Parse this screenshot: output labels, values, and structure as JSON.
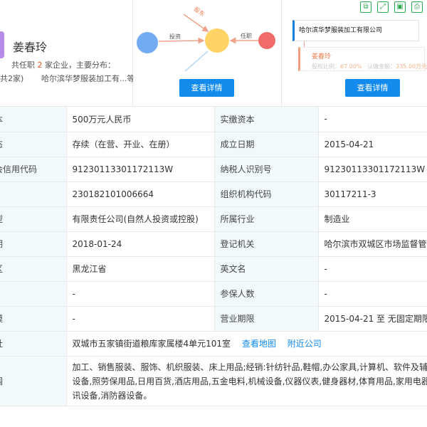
{
  "person": {
    "name": "姜春玲",
    "line1_prefix": "共任职",
    "line1_count": "2",
    "line1_suffix": "家企业，主要分布：",
    "line2_prefix": "共2家)",
    "line2_company": "哈尔滨华梦服装加工有...等"
  },
  "graph": {
    "label_invest": "投资",
    "label_share": "股东",
    "label_role": "任职",
    "colors": {
      "blue": "#5b9cf0",
      "orange": "#ffd366",
      "red": "#f05b5b",
      "arrow": "#f0a38a"
    }
  },
  "structure": {
    "company": "哈尔滨华梦服装加工有限公司",
    "holder_name": "姜春玲",
    "holder_ratio_label": "股权比例：",
    "holder_ratio_value": "67.00%",
    "holder_amount_label": "认缴金额：",
    "holder_amount_value": "335.00万元"
  },
  "toolbar": {
    "icons": [
      "copy-icon",
      "expand-icon",
      "save-icon",
      "print-icon"
    ]
  },
  "buttons": {
    "detail_left": "查看详情",
    "detail_right": "查看详情"
  },
  "table": {
    "rows": [
      {
        "l1": "本",
        "v1": "500万元人民币",
        "l2": "实缴资本",
        "v2": "-"
      },
      {
        "l1": "态",
        "v1": "存续（在营、开业、在册）",
        "l2": "成立日期",
        "v2": "2015-04-21"
      },
      {
        "l1": "会信用代码",
        "v1": "91230113301172113W",
        "l2": "纳税人识别号",
        "v2": "91230113301172113W"
      },
      {
        "l1": "",
        "v1": "230182101006664",
        "l2": "组织机构代码",
        "v2": "30117211-3"
      },
      {
        "l1": "型",
        "v1": "有限责任公司(自然人投资或控股)",
        "l2": "所属行业",
        "v2": "制造业"
      },
      {
        "l1": "期",
        "v1": "2018-01-24",
        "l2": "登记机关",
        "v2": "哈尔滨市双城区市场监督管理局"
      },
      {
        "l1": "区",
        "v1": "黑龙江省",
        "l2": "英文名",
        "v2": "-"
      },
      {
        "l1": "",
        "v1": "-",
        "l2": "参保人数",
        "v2": "-"
      },
      {
        "l1": "模",
        "v1": "-",
        "l2": "营业期限",
        "v2": "2015-04-21 至 无固定期限"
      }
    ],
    "address": {
      "label": "址",
      "value": "双城市五家镇街道粮库家属楼4单元101室",
      "map_link": "查看地图",
      "nearby_link": "附近公司"
    },
    "scope": {
      "label": "围",
      "value": "加工、销售服装、服饰、机织服装、床上用品;经销:针纺针品,鞋帽,办公家具,计算机、软件及辅助设备,照劳保用品,日用百货,酒店用品,五金电料,机械设备,仪器仪表,健身器材,体育用品,家用电器,通讯设备,消防器设备。"
    }
  }
}
